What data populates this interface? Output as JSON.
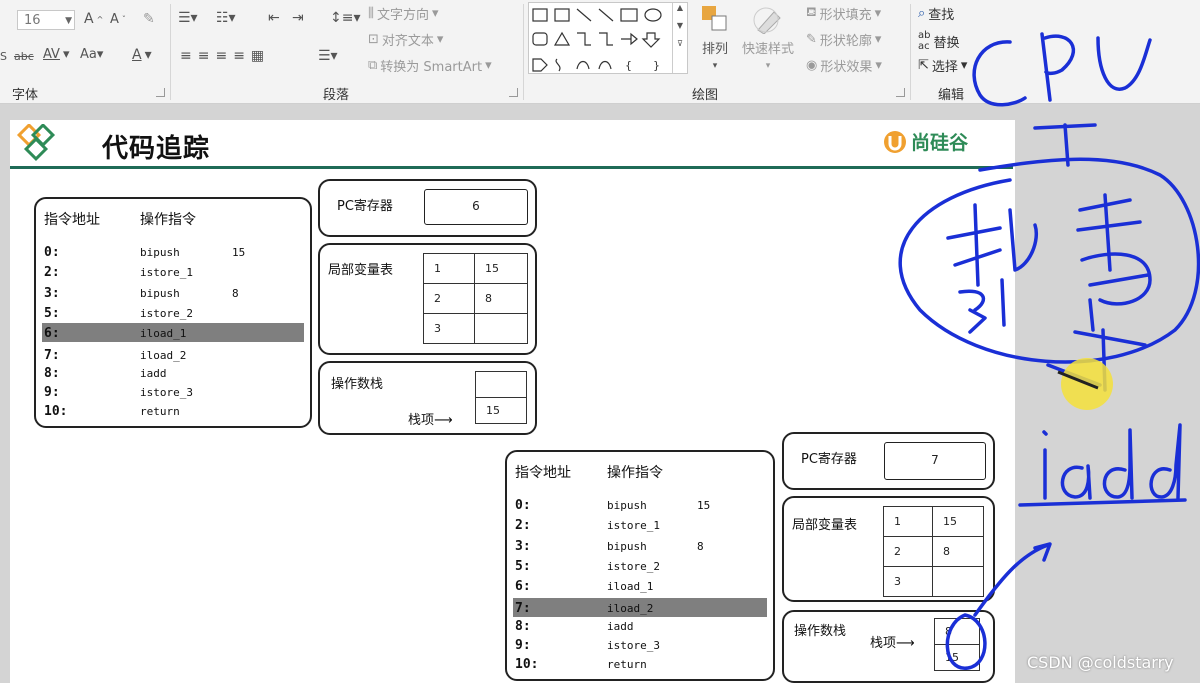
{
  "ribbon": {
    "font": {
      "size_value": "16",
      "group_label": "字体"
    },
    "paragraph": {
      "text_direction": "文字方向",
      "align_text": "对齐文本",
      "convert_smartart": "转换为 SmartArt",
      "group_label": "段落"
    },
    "drawing": {
      "arrange": "排列",
      "quick_styles": "快速样式",
      "shape_fill": "形状填充",
      "shape_outline": "形状轮廓",
      "shape_effects": "形状效果",
      "group_label": "绘图"
    },
    "editing": {
      "find": "查找",
      "replace": "替换",
      "select": "选择",
      "group_label": "编辑"
    }
  },
  "slide": {
    "title": "代码追踪",
    "brand": "尚硅谷",
    "frame1": {
      "instructions": {
        "header_addr": "指令地址",
        "header_op": "操作指令",
        "rows": [
          {
            "addr": "0:",
            "op": "bipush",
            "arg": "15"
          },
          {
            "addr": "2:",
            "op": "istore_1",
            "arg": ""
          },
          {
            "addr": "3:",
            "op": "bipush",
            "arg": "8"
          },
          {
            "addr": "5:",
            "op": "istore_2",
            "arg": ""
          },
          {
            "addr": "6:",
            "op": "iload_1",
            "arg": ""
          },
          {
            "addr": "7:",
            "op": "iload_2",
            "arg": ""
          },
          {
            "addr": "8:",
            "op": "iadd",
            "arg": ""
          },
          {
            "addr": "9:",
            "op": "istore_3",
            "arg": ""
          },
          {
            "addr": "10:",
            "op": "return",
            "arg": ""
          }
        ],
        "highlighted_addr": "6:"
      },
      "pc": {
        "label": "PC寄存器",
        "value": "6"
      },
      "locals": {
        "label": "局部变量表",
        "rows": [
          [
            "1",
            "15"
          ],
          [
            "2",
            "8"
          ],
          [
            "3",
            ""
          ]
        ]
      },
      "operand_stack": {
        "label": "操作数栈",
        "top_label": "栈项",
        "cells": [
          "",
          "15"
        ]
      }
    },
    "frame2": {
      "instructions": {
        "header_addr": "指令地址",
        "header_op": "操作指令",
        "rows": [
          {
            "addr": "0:",
            "op": "bipush",
            "arg": "15"
          },
          {
            "addr": "2:",
            "op": "istore_1",
            "arg": ""
          },
          {
            "addr": "3:",
            "op": "bipush",
            "arg": "8"
          },
          {
            "addr": "5:",
            "op": "istore_2",
            "arg": ""
          },
          {
            "addr": "6:",
            "op": "iload_1",
            "arg": ""
          },
          {
            "addr": "7:",
            "op": "iload_2",
            "arg": ""
          },
          {
            "addr": "8:",
            "op": "iadd",
            "arg": ""
          },
          {
            "addr": "9:",
            "op": "istore_3",
            "arg": ""
          },
          {
            "addr": "10:",
            "op": "return",
            "arg": ""
          }
        ],
        "highlighted_addr": "7:"
      },
      "pc": {
        "label": "PC寄存器",
        "value": "7"
      },
      "locals": {
        "label": "局部变量表",
        "rows": [
          [
            "1",
            "15"
          ],
          [
            "2",
            "8"
          ],
          [
            "3",
            ""
          ]
        ]
      },
      "operand_stack": {
        "label": "操作数栈",
        "top_label": "栈项",
        "cells": [
          "8",
          "15"
        ]
      }
    }
  },
  "annotations": {
    "handwriting_1": "CPU",
    "handwriting_2": "执行引擎",
    "handwriting_3": "iadd",
    "ink_color": "#1a2fd6",
    "pointer_color": "#f5e03a"
  },
  "watermark": "CSDN @coldstarry",
  "colors": {
    "title_rule": "#1f6b57",
    "highlight_row": "#7f7f7f",
    "brand": "#2e8b57"
  }
}
